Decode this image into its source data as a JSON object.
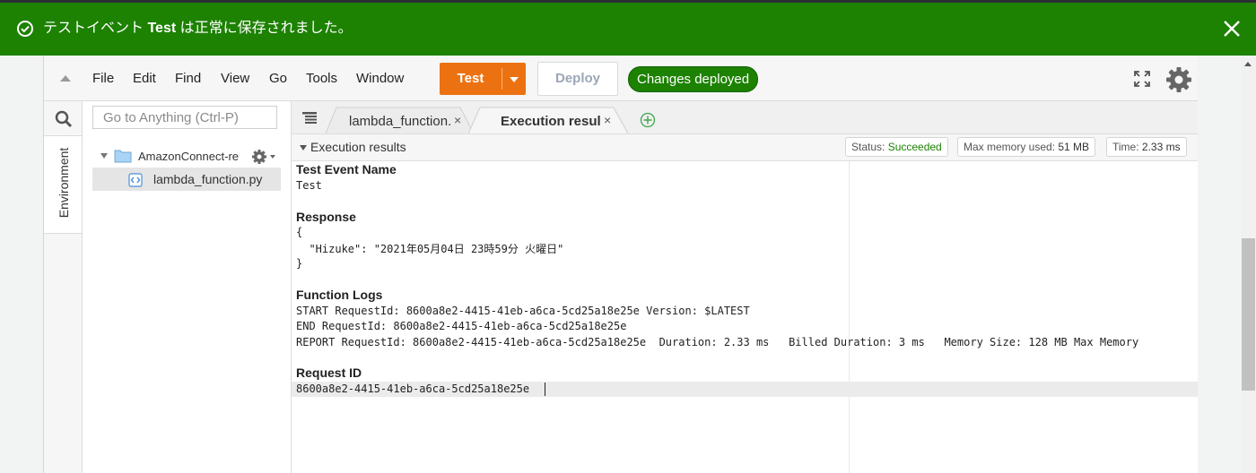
{
  "banner": {
    "message_prefix": "テストイベント ",
    "message_bold": "Test",
    "message_suffix": " は正常に保存されました。",
    "close_label": "×"
  },
  "menu": {
    "items": [
      "File",
      "Edit",
      "Find",
      "View",
      "Go",
      "Tools",
      "Window"
    ]
  },
  "toolbar": {
    "test_label": "Test",
    "deploy_label": "Deploy",
    "status_pill": "Changes deployed"
  },
  "sidebar": {
    "env_tab": "Environment",
    "search_placeholder": "Go to Anything (Ctrl-P)",
    "folder_name": "AmazonConnect-res",
    "file_name": "lambda_function.py"
  },
  "tabs": [
    {
      "label": "lambda_function.",
      "close": "×",
      "active": false
    },
    {
      "label": "Execution results",
      "close": "×",
      "active": true
    }
  ],
  "results": {
    "header": "Execution results",
    "status_label": "Status: ",
    "status_value": "Succeeded",
    "memory_label": "Max memory used: ",
    "memory_value": "51 MB",
    "time_label": "Time: ",
    "time_value": "2.33 ms"
  },
  "output": {
    "test_event_title": "Test Event Name",
    "test_event_value": "Test",
    "response_title": "Response",
    "response_lines": [
      "{",
      "  \"Hizuke\": \"2021年05月04日 23時59分 火曜日\"",
      "}"
    ],
    "logs_title": "Function Logs",
    "log_lines": [
      "START RequestId: 8600a8e2-4415-41eb-a6ca-5cd25a18e25e Version: $LATEST",
      "END RequestId: 8600a8e2-4415-41eb-a6ca-5cd25a18e25e",
      "REPORT RequestId: 8600a8e2-4415-41eb-a6ca-5cd25a18e25e  Duration: 2.33 ms   Billed Duration: 3 ms   Memory Size: 128 MB Max Memory"
    ],
    "request_id_title": "Request ID",
    "request_id_value": "8600a8e2-4415-41eb-a6ca-5cd25a18e25e"
  },
  "colors": {
    "banner_green": "#1d8102",
    "test_orange": "#ec7211",
    "succeeded_green": "#1d8102"
  },
  "icons": [
    "check-circle-icon",
    "close-icon",
    "caret-up-icon",
    "search-icon",
    "folder-icon",
    "gear-icon",
    "python-file-icon",
    "list-icon",
    "plus-circle-icon",
    "expand-icon"
  ]
}
